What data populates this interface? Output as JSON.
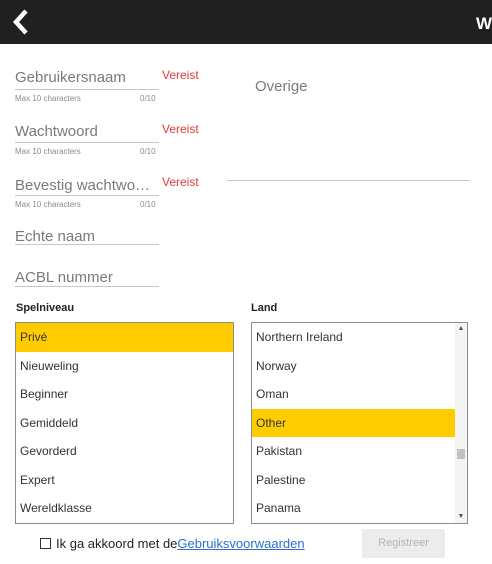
{
  "header": {
    "title_partial": "W",
    "back_icon": "chevron-left-icon",
    "background": "#202020"
  },
  "form": {
    "username": {
      "label": "Gebruikersnaam",
      "required": "Vereist",
      "hint": "Max 10 characters",
      "count": "0/10"
    },
    "password": {
      "label": "Wachtwoord",
      "required": "Vereist",
      "hint": "Max 10 characters",
      "count": "0/10"
    },
    "confirm_password": {
      "label": "Bevestig wachtwo…",
      "required": "Vereist",
      "hint": "Max 10 characters",
      "count": "0/10"
    },
    "real_name": {
      "label": "Echte naam"
    },
    "acbl_number": {
      "label": "ACBL nummer"
    },
    "other": {
      "label": "Overige"
    }
  },
  "skill_level": {
    "label": "Spelniveau",
    "options": [
      "Privé",
      "Nieuweling",
      "Beginner",
      "Gemiddeld",
      "Gevorderd",
      "Expert",
      "Wereldklasse"
    ],
    "selected": "Privé"
  },
  "country": {
    "label": "Land",
    "visible_options": [
      "Northern Ireland",
      "Norway",
      "Oman",
      "Other",
      "Pakistan",
      "Palestine",
      "Panama"
    ],
    "selected": "Other"
  },
  "agreement": {
    "text": "Ik ga akkoord met de",
    "link": "Gebruiksvoorwaarden",
    "checked": false
  },
  "register_button": {
    "label": "Registreer",
    "enabled": false
  },
  "colors": {
    "accent": "#ffcc00",
    "required": "#e23a3a",
    "link": "#2a6fd1"
  }
}
